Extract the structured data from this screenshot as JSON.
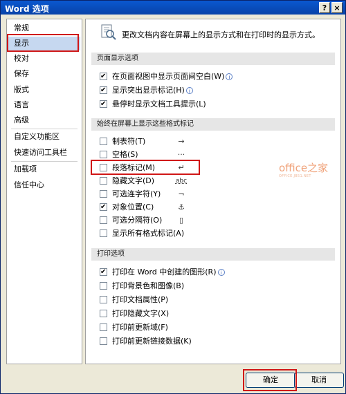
{
  "window": {
    "title": "Word 选项",
    "help_label": "?",
    "close_label": "×"
  },
  "sidebar": {
    "items": [
      {
        "label": "常规"
      },
      {
        "label": "显示"
      },
      {
        "label": "校对"
      },
      {
        "label": "保存"
      },
      {
        "label": "版式"
      },
      {
        "label": "语言"
      },
      {
        "label": "高级"
      },
      {
        "label": "自定义功能区"
      },
      {
        "label": "快速访问工具栏"
      },
      {
        "label": "加载项"
      },
      {
        "label": "信任中心"
      }
    ],
    "selected_index": 1
  },
  "content": {
    "intro": "更改文档内容在屏幕上的显示方式和在打印时的显示方式。",
    "page_display": {
      "header": "页面显示选项",
      "options": [
        {
          "label": "在页面视图中显示页面间空白(W)",
          "checked": true,
          "info": true
        },
        {
          "label": "显示突出显示标记(H)",
          "checked": true,
          "info": true
        },
        {
          "label": "悬停时显示文档工具提示(L)",
          "checked": true,
          "info": false
        }
      ]
    },
    "format_marks": {
      "header": "始终在屏幕上显示这些格式标记",
      "options": [
        {
          "label": "制表符(T)",
          "checked": false,
          "symbol": "→"
        },
        {
          "label": "空格(S)",
          "checked": false,
          "symbol": "···"
        },
        {
          "label": "段落标记(M)",
          "checked": false,
          "symbol": "↵"
        },
        {
          "label": "隐藏文字(D)",
          "checked": false,
          "symbol": "abc"
        },
        {
          "label": "可选连字符(Y)",
          "checked": false,
          "symbol": "¬"
        },
        {
          "label": "对象位置(C)",
          "checked": true,
          "symbol": "⚓"
        },
        {
          "label": "可选分隔符(O)",
          "checked": false,
          "symbol": "▯"
        },
        {
          "label": "显示所有格式标记(A)",
          "checked": false,
          "symbol": ""
        }
      ]
    },
    "print": {
      "header": "打印选项",
      "options": [
        {
          "label": "打印在 Word 中创建的图形(R)",
          "checked": true,
          "info": true
        },
        {
          "label": "打印背景色和图像(B)",
          "checked": false,
          "info": false
        },
        {
          "label": "打印文档属性(P)",
          "checked": false,
          "info": false
        },
        {
          "label": "打印隐藏文字(X)",
          "checked": false,
          "info": false
        },
        {
          "label": "打印前更新域(F)",
          "checked": false,
          "info": false
        },
        {
          "label": "打印前更新链接数据(K)",
          "checked": false,
          "info": false
        }
      ]
    }
  },
  "watermark": {
    "main": "office之家",
    "sub": "OFFICE.JB51.NET"
  },
  "buttons": {
    "ok": "确定",
    "cancel": "取消"
  },
  "colors": {
    "highlight": "#d01616",
    "selected": "#c6d8f0",
    "title_bar": "#0a58d0"
  }
}
